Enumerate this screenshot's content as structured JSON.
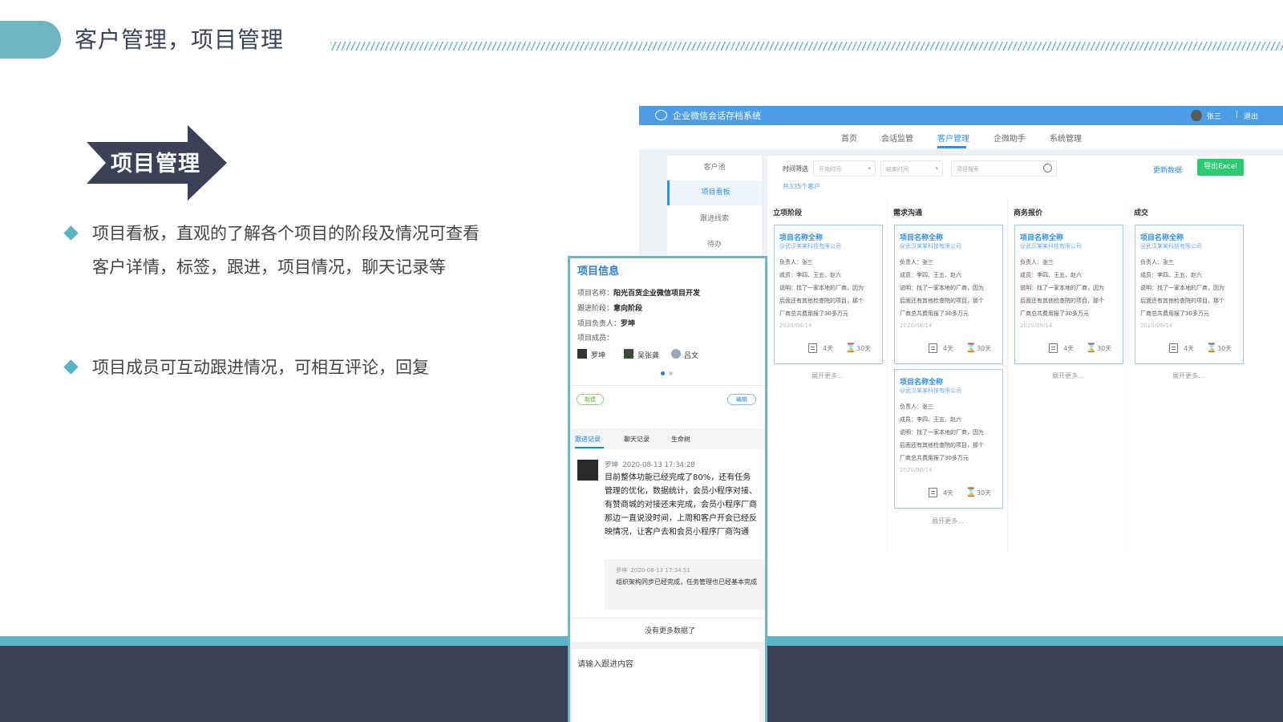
{
  "slide": {
    "title": "客户管理，项目管理",
    "badge": "项目管理",
    "bullets": [
      {
        "text": "项目看板，直观的了解各个项目的阶段及情况可查看客户详情，标签，跟进，项目情况，聊天记录等"
      },
      {
        "text": "项目成员可互动跟进情况，可相互评论，回复"
      }
    ]
  },
  "colors": {
    "teal": "#5ab4c5",
    "navy": "#3b4257",
    "app_blue": "#4c9ce6",
    "export_green": "#2ec973",
    "link_blue": "#2f8fe6"
  },
  "app": {
    "name": "企业微信会话存档系统",
    "user": "张三",
    "separator": "|",
    "logout": "退出",
    "nav": [
      "首页",
      "会话监管",
      "客户管理",
      "企微助手",
      "系统管理"
    ],
    "nav_active": "客户管理",
    "sidebar": [
      "客户池",
      "项目看板",
      "跟进线索",
      "待办"
    ],
    "sidebar_active": "项目看板",
    "filter": {
      "label": "时间筛选",
      "start_placeholder": "开始时间",
      "end_placeholder": "结束时间",
      "search_placeholder": "项目搜索",
      "refresh": "更新数据",
      "export": "导出Excel",
      "total": "共335个客户"
    },
    "columns": [
      {
        "title": "立项阶段",
        "more": "展开更多..."
      },
      {
        "title": "需求沟通",
        "more": "展开更多..."
      },
      {
        "title": "商务报价",
        "more": "展开更多..."
      },
      {
        "title": "成交",
        "more": "展开更多..."
      }
    ],
    "card": {
      "name": "项目名称全称",
      "company": "@武汉某某科技有限公司",
      "owner": "负责人：张三",
      "members": "成员：李四、王五、赵六",
      "desc1": "说明：找了一家本地的厂商，因为",
      "desc2": "后面还有其他检查院的项目，那个",
      "desc3": "厂商总共费用报了30多万元",
      "date": "2020/08/14",
      "days": "4天",
      "deadline": "30天"
    }
  },
  "phone": {
    "title": "项目信息",
    "project_name_label": "项目名称：",
    "project_name": "阳光百货企业微信项目开发",
    "stage_label": "跟进阶段：",
    "stage": "意向阶段",
    "leader_label": "项目负责人：",
    "leader": "罗坤",
    "members_label": "项目成员：",
    "members": [
      "罗坤",
      "吴张龚",
      "吕文"
    ],
    "new_btn": "新建",
    "edit_btn": "编辑",
    "tabs": [
      "跟进记录",
      "聊天记录",
      "生命树"
    ],
    "comment": {
      "author": "罗坤",
      "time": "2020-08-13 17:34:28",
      "body": "目前整体功能已经完成了80%，还有任务管理的优化，数据统计，会员小程序对接、有赞商城的对接还未完成，会员小程序厂商那边一直说没时间，上周和客户开会已经反映情况，让客户去和会员小程序厂商沟通"
    },
    "reply": {
      "author": "罗坤",
      "time": "2020-08-13 17:34:51",
      "body": "组织架构同步已经完成，任务管理也已经基本完成"
    },
    "no_more": "没有更多数据了",
    "input_placeholder": "请输入跟进内容"
  }
}
